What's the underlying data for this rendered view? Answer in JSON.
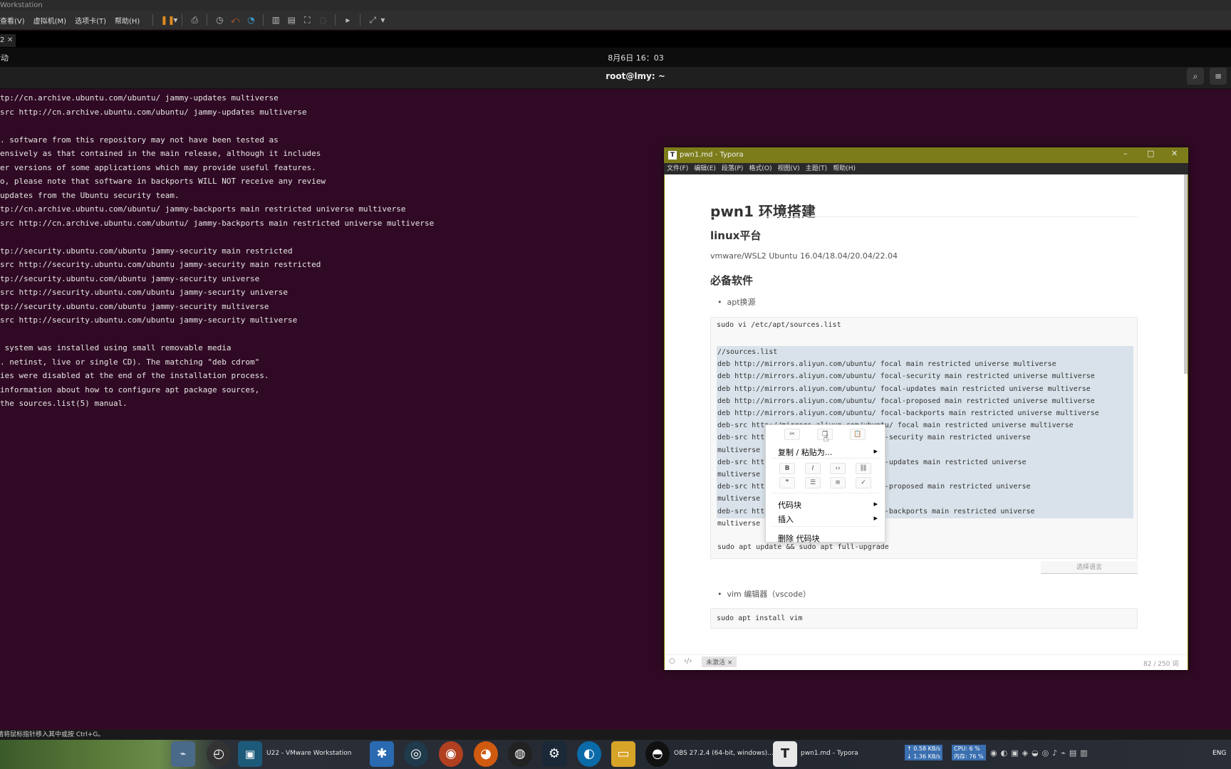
{
  "vmware": {
    "title": "Workstation",
    "menu": [
      "查看(V)",
      "虚拟机(M)",
      "选项卡(T)",
      "帮助(H)"
    ],
    "tab_label": "2",
    "status_text": "请将鼠标指针移入其中或按 Ctrl+G。"
  },
  "gnome": {
    "activities": "活动",
    "clock": "8月6日 16：03"
  },
  "terminal": {
    "title": "root@lmy: ~",
    "lines": [
      "tp://cn.archive.ubuntu.com/ubuntu/ jammy-updates multiverse",
      "src http://cn.archive.ubuntu.com/ubuntu/ jammy-updates multiverse",
      "",
      ". software from this repository may not have been tested as",
      "ensively as that contained in the main release, although it includes",
      "er versions of some applications which may provide useful features.",
      "o, please note that software in backports WILL NOT receive any review",
      "updates from the Ubuntu security team.",
      "tp://cn.archive.ubuntu.com/ubuntu/ jammy-backports main restricted universe multiverse",
      "src http://cn.archive.ubuntu.com/ubuntu/ jammy-backports main restricted universe multiverse",
      "",
      "tp://security.ubuntu.com/ubuntu jammy-security main restricted",
      "src http://security.ubuntu.com/ubuntu jammy-security main restricted",
      "tp://security.ubuntu.com/ubuntu jammy-security universe",
      "src http://security.ubuntu.com/ubuntu jammy-security universe",
      "tp://security.ubuntu.com/ubuntu jammy-security multiverse",
      "src http://security.ubuntu.com/ubuntu jammy-security multiverse",
      "",
      " system was installed using small removable media",
      ". netinst, live or single CD). The matching \"deb cdrom\"",
      "ies were disabled at the end of the installation process.",
      "information about how to configure apt package sources,",
      "the sources.list(5) manual."
    ]
  },
  "typora": {
    "title": "pwn1.md - Typora",
    "menu": [
      "文件(F)",
      "编辑(E)",
      "段落(P)",
      "格式(O)",
      "视图(V)",
      "主题(T)",
      "帮助(H)"
    ],
    "h1": "pwn1 环境搭建",
    "h2_linux": "linux平台",
    "p_platform": "vmware/WSL2  Ubuntu 16.04/18.04/20.04/22.04",
    "h2_software": "必备软件",
    "li_apt": "apt换源",
    "code1_first": "sudo vi /etc/apt/sources.list",
    "code1_selected": [
      "//sources.list",
      "deb http://mirrors.aliyun.com/ubuntu/ focal main restricted universe multiverse",
      "deb http://mirrors.aliyun.com/ubuntu/ focal-security main restricted universe multiverse",
      "deb http://mirrors.aliyun.com/ubuntu/ focal-updates main restricted universe multiverse",
      "deb http://mirrors.aliyun.com/ubuntu/ focal-proposed main restricted universe multiverse",
      "deb http://mirrors.aliyun.com/ubuntu/ focal-backports main restricted universe multiverse",
      "deb-src http://mirrors.aliyun.com/ubuntu/ focal main restricted universe multiverse",
      "deb-src htt                 untu/ focal-security main restricted universe",
      "multiverse",
      "deb-src htt                 untu/ focal-updates main restricted universe",
      "multiverse",
      "deb-src htt                 untu/ focal-proposed main restricted universe",
      "multiverse",
      "deb-src htt                 untu/ focal-backports main restricted universe",
      "multiverse"
    ],
    "code1_last": "sudo apt update && sudo apt full-upgrade",
    "lang_select": "选择语言",
    "li_vim": "vim 编辑器（vscode）",
    "code2": "sudo apt install vim",
    "footer_badge": "未激活 ×",
    "word_count": "82 / 250 词"
  },
  "context_menu": {
    "copy_paste_as": "复制 / 粘贴为...",
    "code_block": "代码块",
    "insert": "插入",
    "delete_code_block": "删除 代码块"
  },
  "taskbar": {
    "vmware_label": "U22 - VMware Workstation",
    "obs_label": "OBS 27.2.4 (64-bit, windows)...",
    "typora_label": "pwn1.md - Typora",
    "net_up": "↑ 0.58 KB/s",
    "net_down": "↓ 1.36 KB/s",
    "cpu": "CPU: 6 %",
    "mem": "内存: 76 %",
    "lang": "ENG"
  }
}
